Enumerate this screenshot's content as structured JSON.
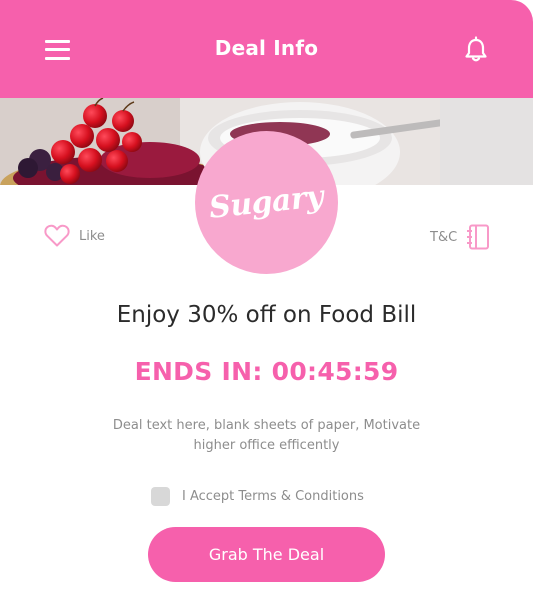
{
  "header": {
    "title": "Deal Info",
    "menu_icon": "hamburger-menu-icon",
    "bell_icon": "bell-icon"
  },
  "brand": {
    "logo_text": "Sugary"
  },
  "actions": {
    "like_label": "Like",
    "tc_label": "T&C"
  },
  "deal": {
    "headline": "Enjoy 30% off on Food Bill",
    "countdown": "ENDS IN: 00:45:59",
    "description": "Deal text here, blank sheets of paper, Motivate higher office efficently"
  },
  "terms": {
    "label": "I Accept Terms & Conditions",
    "checked": false
  },
  "cta": {
    "label": "Grab The Deal"
  },
  "colors": {
    "accent": "#f660ac",
    "logo_bg": "#f8a8cf",
    "text_muted": "#8d8d8d"
  }
}
